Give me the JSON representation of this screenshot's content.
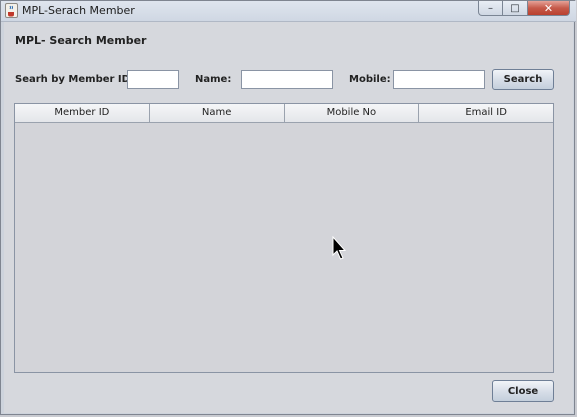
{
  "window": {
    "title": "MPL-Serach Member",
    "controls": {
      "minimize_glyph": "–",
      "maximize_glyph": "□",
      "close_glyph": "✕"
    }
  },
  "form": {
    "heading": "MPL- Search Member",
    "member_id_label": "Searh by Member ID:",
    "member_id_value": "",
    "name_label": "Name:",
    "name_value": "",
    "mobile_label": "Mobile:",
    "mobile_value": "",
    "search_button": "Search"
  },
  "table": {
    "columns": [
      "Member ID",
      "Name",
      "Mobile No",
      "Email ID"
    ],
    "rows": []
  },
  "footer": {
    "close_button": "Close"
  },
  "icons": {
    "app_icon": "java-coffee-cup-icon",
    "cursor": "mouse-pointer-icon"
  },
  "colors": {
    "window_bg": "#d6d8dd",
    "close_button_red": "#c65a4a",
    "button_border": "#6f7f96"
  }
}
